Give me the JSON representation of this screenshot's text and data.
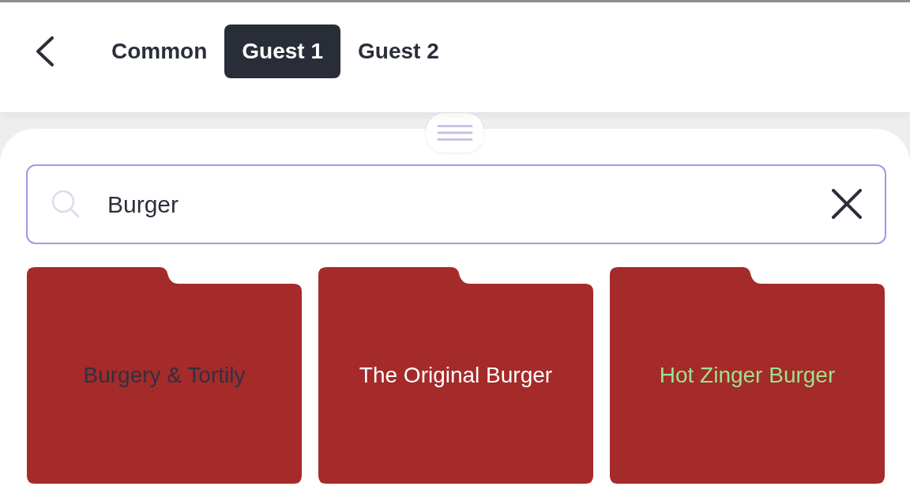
{
  "tabs": [
    {
      "label": "Common",
      "selected": false
    },
    {
      "label": "Guest 1",
      "selected": true
    },
    {
      "label": "Guest 2",
      "selected": false
    }
  ],
  "search": {
    "value": "Burger"
  },
  "folders": [
    {
      "label": "Burgery & Tortily",
      "color": "#2f3241"
    },
    {
      "label": "The Original Burger",
      "color": "#ffffff"
    },
    {
      "label": "Hot Zinger Burger",
      "color": "#9be38c"
    }
  ]
}
